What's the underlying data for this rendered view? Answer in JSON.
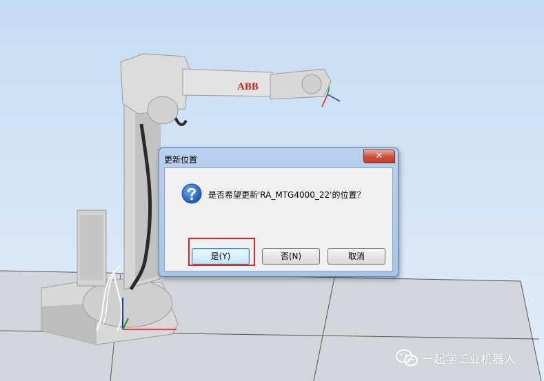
{
  "dialog": {
    "title": "更新位置",
    "close_glyph": "✕",
    "message": "是否希望更新'RA_MTG4000_22'的位置？",
    "buttons": {
      "yes": "是(Y)",
      "no": "否(N)",
      "cancel": "取消"
    }
  },
  "robot": {
    "brand_label": "ABB"
  },
  "watermark": {
    "text": "一起学工业机器人",
    "icon": "wechat-icon"
  },
  "colors": {
    "highlight": "#e0202a",
    "brand_red": "#d21a1a",
    "sky": "#cfe0f4"
  }
}
